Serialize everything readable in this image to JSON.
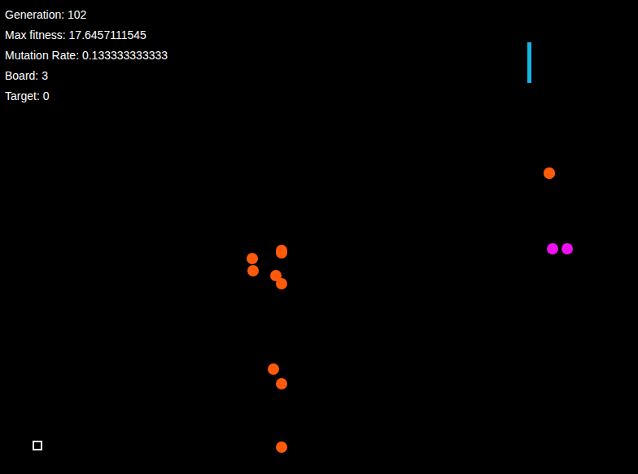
{
  "hud": [
    "Generation: 102",
    "Max fitness: 17.6457111545",
    "Mutation Rate: 0.133333333333",
    "Board: 3",
    "Target: 0"
  ],
  "agents": [
    {
      "color": "#ff5a0a"
    },
    {
      "color": "#ff5a0a"
    },
    {
      "color": "#ff5a0a"
    },
    {
      "color": "#ff5a0a"
    },
    {
      "color": "#ff5a0a"
    },
    {
      "color": "#ff5a0a"
    },
    {
      "color": "#ff5a0a"
    },
    {
      "color": "#ff5a0a"
    },
    {
      "color": "#ff5a0a"
    },
    {
      "color": "#ff5a0a"
    },
    {
      "color": "#ff5a0a"
    },
    {
      "color": "#ee11ee"
    },
    {
      "color": "#ee11ee"
    }
  ]
}
